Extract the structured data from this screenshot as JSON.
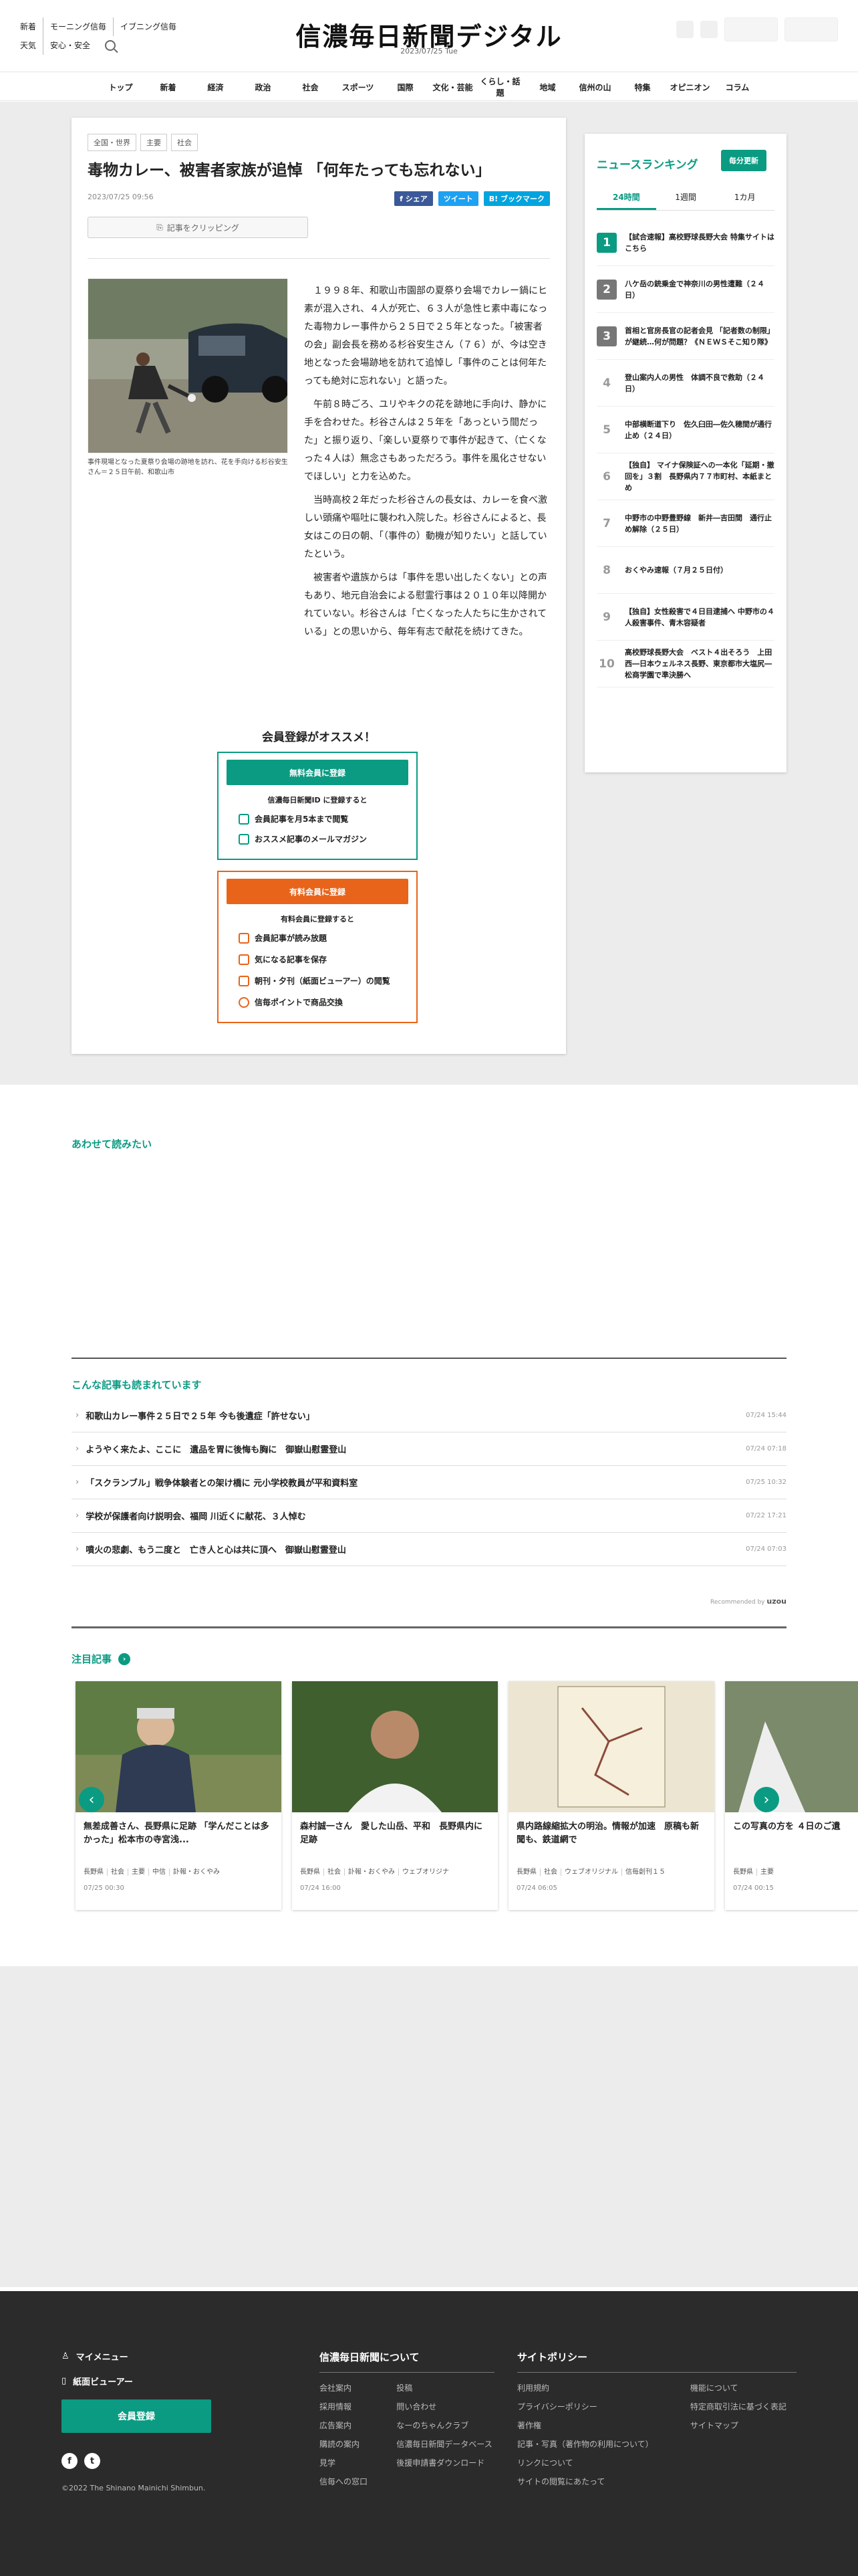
{
  "header": {
    "links_row1": [
      "新着",
      "モーニング信毎",
      "イブニング信毎"
    ],
    "links_row2": [
      "天気",
      "安心・安全"
    ],
    "logo": "信濃毎日新聞デジタル",
    "date": "2023/07/25 Tue"
  },
  "nav": [
    "トップ",
    "新着",
    "経済",
    "政治",
    "社会",
    "スポーツ",
    "国際",
    "文化・芸能",
    "くらし・話題",
    "地域",
    "信州の山",
    "特集",
    "オピニオン",
    "コラム"
  ],
  "article": {
    "tags": [
      "全国・世界",
      "主要",
      "社会"
    ],
    "title": "毒物カレー、被害者家族が追悼 「何年たっても忘れない」",
    "published": "2023/07/25 09:56",
    "share": {
      "facebook": "f シェア",
      "twitter": "ツイート",
      "hatena": "B! ブックマーク"
    },
    "clip_label": "記事をクリッピング",
    "caption": "事件現場となった夏祭り会場の跡地を訪れ、花を手向ける杉谷安生さん＝２５日午前、和歌山市",
    "paragraphs": [
      "１９９８年、和歌山市園部の夏祭り会場でカレー鍋にヒ素が混入され、４人が死亡、６３人が急性ヒ素中毒になった毒物カレー事件から２５日で２５年となった。「被害者の会」副会長を務める杉谷安生さん（７６）が、今は空き地となった会場跡地を訪れて追悼し「事件のことは何年たっても絶対に忘れない」と語った。",
      "午前８時ごろ、ユリやキクの花を跡地に手向け、静かに手を合わせた。杉谷さんは２５年を「あっという間だった」と振り返り、「楽しい夏祭りで事件が起きて、（亡くなった４人は）無念さもあっただろう。事件を風化させないでほしい」と力を込めた。",
      "当時高校２年だった杉谷さんの長女は、カレーを食べ激しい頭痛や嘔吐に襲われ入院した。杉谷さんによると、長女はこの日の朝、「（事件の）動機が知りたい」と話していたという。",
      "被害者や遺族からは「事件を思い出したくない」との声もあり、地元自治会による慰霊行事は２０１０年以降開かれていない。杉谷さんは「亡くなった人たちに生かされている」との思いから、毎年有志で献花を続けてきた。"
    ]
  },
  "register": {
    "heading": "会員登録がオススメ！",
    "free": {
      "button": "無料会員に登録",
      "sub": "信濃毎日新聞ID に登録すると",
      "items": [
        "会員記事を月5本まで閲覧",
        "おススメ記事のメールマガジン"
      ]
    },
    "paid": {
      "button": "有料会員に登録",
      "sub": "有料会員に登録すると",
      "items": [
        "会員記事が読み放題",
        "気になる記事を保存",
        "朝刊・夕刊（紙面ビューアー）の閲覧",
        "信毎ポイントで商品交換"
      ]
    }
  },
  "ranking": {
    "title": "ニュースランキング",
    "badge": "毎分更新",
    "tabs": [
      "24時間",
      "1週間",
      "1カ月"
    ],
    "items": [
      "【試合速報】高校野球長野大会 特集サイトはこちら",
      "八ケ岳の銃乗金で神奈川の男性遭難（２４日）",
      "首相と官房長官の記者会見 「記者数の制限」が継続…何が問題？《ＮＥＷＳそこ知り隊》",
      "登山案内人の男性　体調不良で救助（２４日）",
      "中部横断道下り　佐久臼田―佐久穂間が通行止め（２４日）",
      "【独自】 マイナ保険証への一本化「延期・撤回を」３割　長野県内７７市町村、本紙まとめ",
      "中野市の中野豊野線　新井―吉田間　通行止め解除（２５日）",
      "おくやみ速報（７月２５日付）",
      "【独自】女性殺害で４日目逮捕へ 中野市の４人殺害事件、青木容疑者",
      "高校野球長野大会　ベスト４出そろう　上田西―日本ウェルネス長野、東京都市大塩尻―松商学園で準決勝へ"
    ]
  },
  "related": {
    "title1": "あわせて読みたい",
    "title2": "こんな記事も読まれています",
    "items": [
      {
        "text": "和歌山カレー事件２５日で２５年 今も後遺症「許せない」",
        "date": "07/24 15:44"
      },
      {
        "text": "ようやく来たよ、ここに　遺品を胃に後悔も胸に　御嶽山慰霊登山",
        "date": "07/24 07:18"
      },
      {
        "text": "「スクランブル」戦争体験者との架け橋に 元小学校教員が平和資料室",
        "date": "07/25 10:32"
      },
      {
        "text": "学校が保護者向け説明会、福岡 川近くに献花、３人悼む",
        "date": "07/22 17:21"
      },
      {
        "text": "噴火の悲劇、もう二度と　亡き人と心は共に頂へ　御嶽山慰霊登山",
        "date": "07/24 07:03"
      }
    ],
    "recommended": "Recommended by",
    "reco_brand": "uzou"
  },
  "featured": {
    "title": "注目記事",
    "cards": [
      {
        "title": "無差成善さん、長野県に足跡 「学んだことは多かった」松本市の寺宮浅...",
        "tags": [
          "長野県",
          "社会",
          "主要",
          "中信",
          "訃報・おくやみ"
        ],
        "date": "07/25 00:30"
      },
      {
        "title": "森村誠一さん　愛した山岳、平和　長野県内に足跡",
        "tags": [
          "長野県",
          "社会",
          "訃報・おくやみ",
          "ウェブオリジナ"
        ],
        "date": "07/24 16:00"
      },
      {
        "title": "県内路線縮拡大の明治。情報が加速　原稿も新聞も、鉄道網で",
        "tags": [
          "長野県",
          "社会",
          "ウェブオリジナル",
          "信毎創刊１５"
        ],
        "date": "07/24 06:05"
      },
      {
        "title": "この写真の方を ４日のご遺",
        "tags": [
          "長野県",
          "主要"
        ],
        "date": "07/24 00:15"
      }
    ]
  },
  "footer": {
    "my_menu": "マイメニュー",
    "viewer": "紙面ビューアー",
    "register": "会員登録",
    "copyright": "©2022 The Shinano Mainichi Shimbun.",
    "about_title": "信濃毎日新聞について",
    "about": [
      "会社案内",
      "採用情報",
      "広告案内",
      "購読の案内",
      "見学",
      "信毎への窓口",
      "投稿",
      "問い合わせ",
      "なーのちゃんクラブ",
      "信濃毎日新聞データベース",
      "後援申請書ダウンロード"
    ],
    "policy_title": "サイトポリシー",
    "policy": [
      "利用規約",
      "プライバシーポリシー",
      "著作権",
      "記事・写真（著作物の利用について）",
      "リンクについて",
      "サイトの閲覧にあたって",
      "機能について",
      "特定商取引法に基づく表記",
      "サイトマップ"
    ]
  },
  "colors": {
    "accent": "#0b9b83",
    "orange": "#e8641a",
    "footer": "#2b2b2b"
  }
}
